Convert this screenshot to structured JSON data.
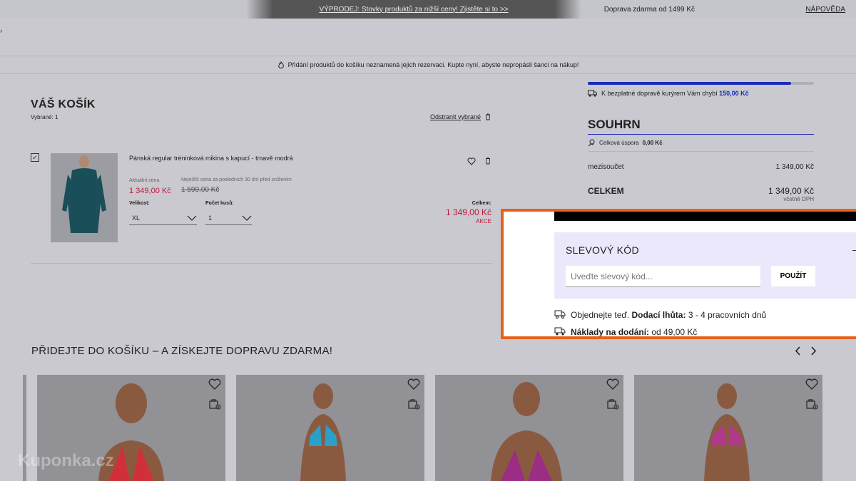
{
  "topbar": {
    "promo": "VÝPRODEJ: Stovky produktů za nižší ceny! Zjistěte si to >>",
    "free_shipping": "Doprava zdarma od 1499 Kč",
    "help": "NÁPOVĚDA"
  },
  "notice": "Přidání produktů do košíku neznamená jejich rezervaci. Kupte nyní, abyste nepropásli šanci na nákup!",
  "cart": {
    "title": "VÁŠ KOŠÍK",
    "selected": "Vybrané: 1",
    "remove_selected": "Odstranit vybrané",
    "item": {
      "name": "Pánská regular tréninková mikina s kapucí - tmavě modrá",
      "current_price_label": "Aktuální cena",
      "current_price": "1 349,00 Kč",
      "lowest_price_label": "Nejnižší cena za posledních 30 dní před snížením",
      "lowest_price": "1 599,00 Kč",
      "size_label": "Velikost:",
      "size_value": "XL",
      "qty_label": "Počet kusů:",
      "qty_value": "1",
      "total_label": "Celkem:",
      "total_value": "1 349,00 Kč",
      "badge": "AKCE"
    }
  },
  "summary": {
    "shipping_progress": 0.9,
    "shipping_msg": "K bezplatné dopravě kurýrem Vám chybí",
    "shipping_missing": "150,00 Kč",
    "title": "SOUHRN",
    "savings_label": "Celková úspora",
    "savings_value": "0,00 Kč",
    "subtotal_label": "mezisoučet",
    "subtotal_value": "1 349,00 Kč",
    "total_label": "CELKEM",
    "total_value": "1 349,00 Kč",
    "vat_note": "včetně DPH"
  },
  "coupon": {
    "title": "SLEVOVÝ KÓD",
    "placeholder": "Uveďte slevový kód...",
    "apply": "POUŽÍT",
    "delivery_prefix": "Objednejte teď.",
    "delivery_label": "Dodací lhůta:",
    "delivery_value": "3 - 4 pracovních dnů",
    "cost_label": "Náklady na dodání:",
    "cost_value": "od 49,00 Kč"
  },
  "recommendations": {
    "title": "PŘIDEJTE DO KOŠÍKU – A ZÍSKEJTE DOPRAVU ZDARMA!"
  },
  "watermark": "Kuponka.cz",
  "colors": {
    "accent_blue": "#1a2bb8",
    "sale_red": "#c0183a",
    "highlight_orange": "#e8601c",
    "coupon_bg": "#ebe8fb"
  }
}
